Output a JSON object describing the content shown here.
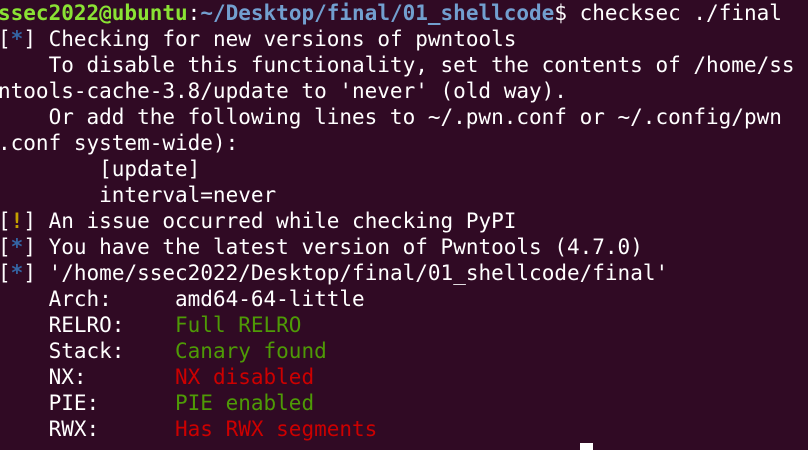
{
  "prompt": {
    "user_host": "ssec2022@ubuntu",
    "sep": ":",
    "path": "~/Desktop/final/01_shellcode",
    "symbol": "$",
    "command": " checksec ./final"
  },
  "output": {
    "line1": " Checking for new versions of pwntools",
    "line2": "    To disable this functionality, set the contents of /home/ss",
    "line3": "ntools-cache-3.8/update to 'never' (old way).",
    "line4": "    Or add the following lines to ~/.pwn.conf or ~/.config/pwn",
    "line5": ".conf system-wide):",
    "line6": "        [update]",
    "line7": "        interval=never",
    "line8": " An issue occurred while checking PyPI",
    "line9": " You have the latest version of Pwntools (4.7.0)",
    "line10": " '/home/ssec2022/Desktop/final/01_shellcode/final'"
  },
  "brackets": {
    "open": "[",
    "close": "]",
    "star": "*",
    "bang": "!"
  },
  "checksec": [
    {
      "key": "    Arch:     ",
      "value": "amd64-64-little"
    },
    {
      "key": "    RELRO:    ",
      "value": "Full RELRO"
    },
    {
      "key": "    Stack:    ",
      "value": "Canary found"
    },
    {
      "key": "    NX:       ",
      "value": "NX disabled"
    },
    {
      "key": "    PIE:      ",
      "value": "PIE enabled"
    },
    {
      "key": "    RWX:      ",
      "value": "Has RWX segments"
    }
  ],
  "colors": {
    "background": "#300a24",
    "prompt_user": "#8ae234",
    "prompt_path": "#729fcf",
    "good": "#4e9a06",
    "bad": "#cc0000",
    "info": "#3465a4",
    "warn": "#c4a000"
  }
}
